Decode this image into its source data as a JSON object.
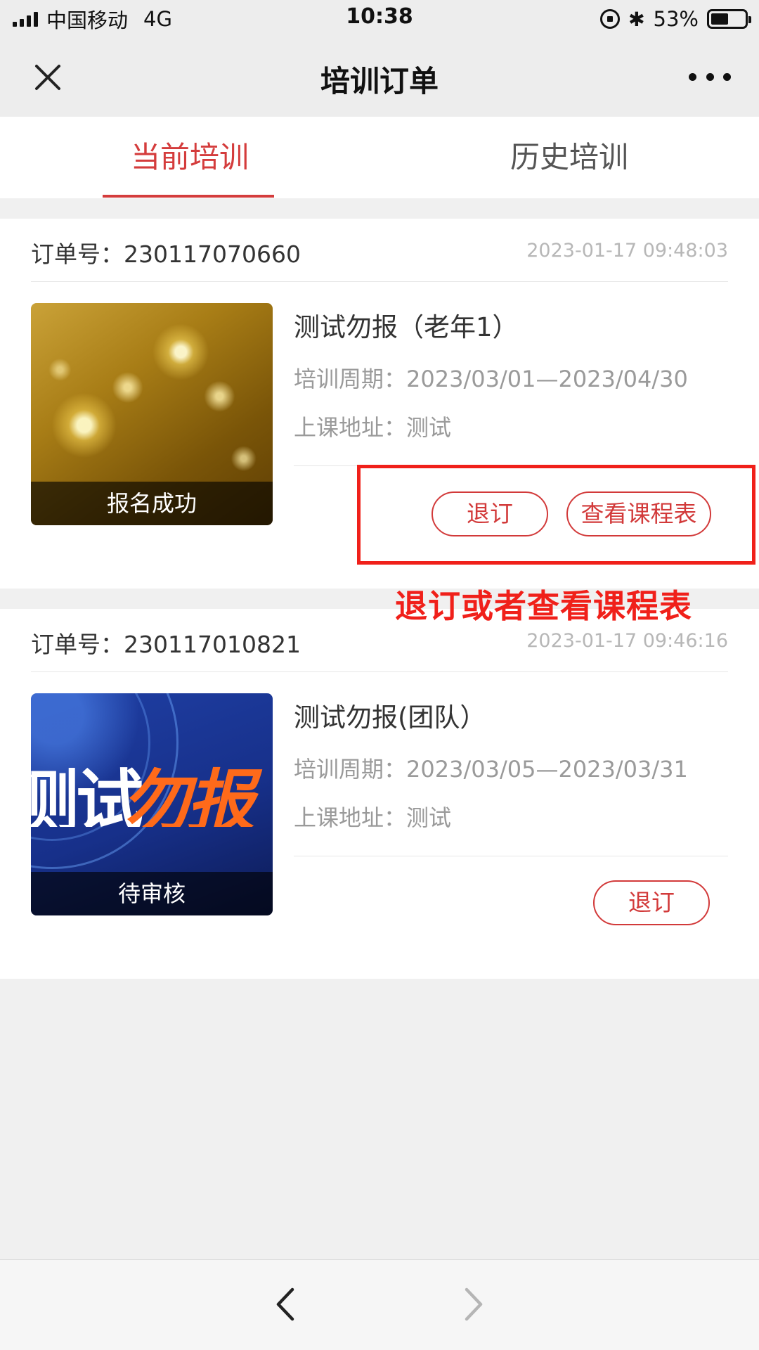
{
  "status_bar": {
    "carrier": "中国移动",
    "network": "4G",
    "time": "10:38",
    "battery": "53%",
    "battery_level": 0.53
  },
  "nav": {
    "title": "培训订单"
  },
  "tabs": [
    {
      "label": "当前培训",
      "active": true
    },
    {
      "label": "历史培训",
      "active": false
    }
  ],
  "orders": [
    {
      "order_label": "订单号：230117070660",
      "time": "2023-01-17 09:48:03",
      "status": "报名成功",
      "course_name": "测试勿报（老年1）",
      "period_label": "培训周期：",
      "period_value": "2023/03/01—2023/04/30",
      "address_label": "上课地址：",
      "address_value": "测试",
      "buttons": [
        "退订",
        "查看课程表"
      ]
    },
    {
      "order_label": "订单号：230117010821",
      "time": "2023-01-17 09:46:16",
      "status": "待审核",
      "course_name": "测试勿报(团队）",
      "period_label": "培训周期：",
      "period_value": "2023/03/05—2023/03/31",
      "address_label": "上课地址：",
      "address_value": "测试",
      "thumb_text_white": "测试",
      "thumb_text_orange": "勿报",
      "buttons": [
        "退订"
      ]
    }
  ],
  "annotation": {
    "text": "退订或者查看课程表",
    "color": "#f0201a"
  },
  "colors": {
    "accent": "#d43c3c"
  }
}
